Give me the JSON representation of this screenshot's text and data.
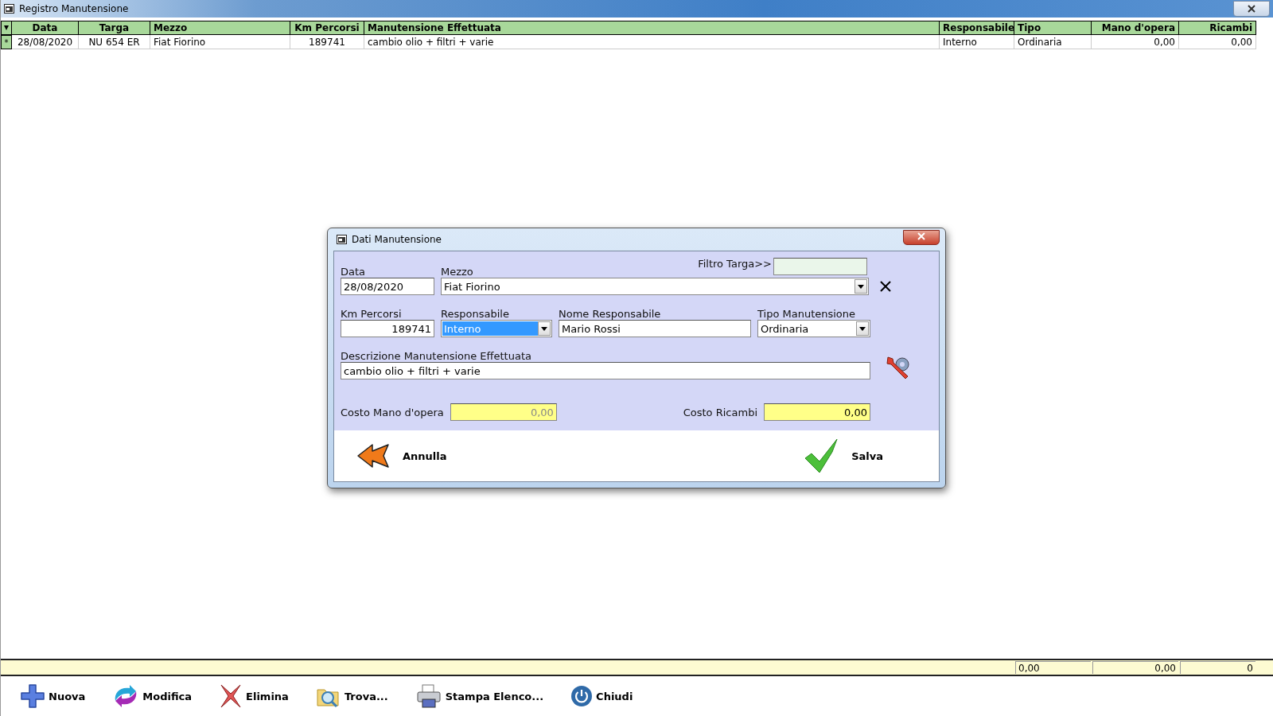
{
  "window": {
    "title": "Registro Manutensione"
  },
  "table": {
    "columns": [
      {
        "label": "Data"
      },
      {
        "label": "Targa"
      },
      {
        "label": "Mezzo"
      },
      {
        "label": "Km Percorsi"
      },
      {
        "label": "Manutensione Effettuata"
      },
      {
        "label": "Responsabile"
      },
      {
        "label": "Tipo"
      },
      {
        "label": "Mano d'opera"
      },
      {
        "label": "Ricambi"
      }
    ],
    "rows": [
      {
        "marker": "*",
        "cells": [
          "28/08/2020",
          "NU 654 ER",
          "Fiat Fiorino",
          "189741",
          "cambio olio + filtri + varie",
          "Interno",
          "Ordinaria",
          "0,00",
          "0,00"
        ]
      }
    ]
  },
  "totals": [
    "0,00",
    "0,00",
    "0"
  ],
  "toolbar": [
    {
      "label": "Nuova",
      "kind": "plus"
    },
    {
      "label": "Modifica",
      "kind": "arrows"
    },
    {
      "label": "Elimina",
      "kind": "cross"
    },
    {
      "label": "Trova...",
      "kind": "find"
    },
    {
      "label": "Stampa Elenco...",
      "kind": "print"
    },
    {
      "label": "Chiudi",
      "kind": "power"
    }
  ],
  "dialog": {
    "title": "Dati Manutensione",
    "filter": {
      "label": "Filtro Targa>>"
    },
    "rows": [
      [
        {
          "label": "Data",
          "value": "28/08/2020",
          "kind": "text"
        },
        {
          "label": "Mezzo",
          "value": "Fiat Fiorino",
          "kind": "combo",
          "highlighted": false
        }
      ],
      [
        {
          "label": "Km Percorsi",
          "value": "189741",
          "kind": "text"
        },
        {
          "label": "Responsabile",
          "value": "Interno",
          "kind": "combo",
          "highlighted": true
        },
        {
          "label": "Nome Responsabile",
          "value": "Mario Rossi",
          "kind": "text"
        },
        {
          "label": "Tipo Manutensione",
          "value": "Ordinaria",
          "kind": "combo",
          "highlighted": false
        }
      ],
      [
        {
          "label": "Descrizione Manutensione Effettuata",
          "value": "cambio olio + filtri + varie",
          "kind": "text"
        }
      ]
    ],
    "costs": [
      {
        "label": "Costo Mano d'opera",
        "value": "0,00",
        "disabled": true
      },
      {
        "label": "Costo Ricambi",
        "value": "0,00",
        "disabled": false
      }
    ],
    "buttons": [
      {
        "label": "Annulla",
        "kind": "back"
      },
      {
        "label": "Salva",
        "kind": "ok"
      }
    ]
  }
}
